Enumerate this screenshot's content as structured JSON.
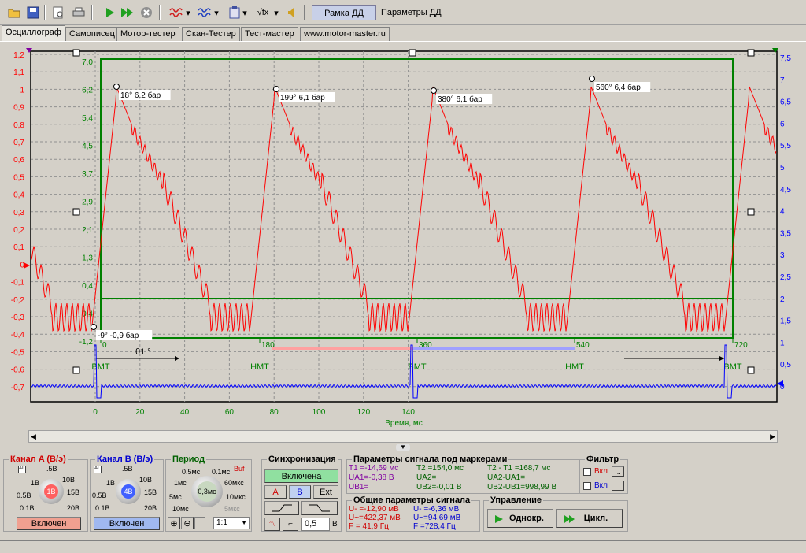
{
  "toolbar": {
    "frame_button": "Рамка ДД",
    "params_label": "Параметры ДД"
  },
  "tabs": [
    {
      "label": "Осциллограф"
    },
    {
      "label": "Самописец"
    },
    {
      "label": "Мотор-тестер"
    },
    {
      "label": "Скан-Тестер"
    },
    {
      "label": "Тест-мастер"
    },
    {
      "label": "www.motor-master.ru"
    }
  ],
  "plot": {
    "left_axis_ticks": [
      "1,2",
      "1,1",
      "1",
      "0,9",
      "0,8",
      "0,7",
      "0,6",
      "0,5",
      "0,4",
      "0,3",
      "0,2",
      "0,1",
      "0",
      "-0,1",
      "-0,2",
      "-0,3",
      "-0,4",
      "-0,5",
      "-0,6",
      "-0,7"
    ],
    "right_axis_ticks": [
      "7,5",
      "7",
      "6,5",
      "6",
      "5,5",
      "5",
      "4,5",
      "4",
      "3,5",
      "3",
      "2,5",
      "2",
      "1,5",
      "1",
      "0,5",
      "0"
    ],
    "pressure_ticks": [
      "7,0",
      "6,2",
      "5,4",
      "4,5",
      "3,7",
      "2,9",
      "2,1",
      "1,3",
      "0,4",
      "-0,4",
      "-1,2"
    ],
    "x_ticks": [
      "0",
      "20",
      "40",
      "60",
      "80",
      "100",
      "120",
      "140"
    ],
    "x_label": "Время, мс",
    "angle_marks": [
      "0",
      "180",
      "360",
      "540",
      "720"
    ],
    "dead_centers": [
      "ВМТ",
      "НМТ",
      "ВМТ",
      "НМТ",
      "ВМТ"
    ],
    "angle_label": "θ1 °",
    "annotations": [
      "18° 6,2 бар",
      "199° 6,1 бар",
      "380° 6,1 бар",
      "560° 6,4 бар",
      "-9° -0,9 бар"
    ]
  },
  "chA": {
    "title": "Канал A (В/э)",
    "ranges": [
      ".5В",
      "1В",
      "10В",
      "0.5В",
      "15В",
      "0.1В",
      "20В"
    ],
    "value": "1В",
    "state": "Включен"
  },
  "chB": {
    "title": "Канал B (В/э)",
    "ranges": [
      ".5В",
      "1В",
      "10В",
      "0.5В",
      "15В",
      "0.1В",
      "20В"
    ],
    "value": "4В",
    "state": "Включен"
  },
  "period": {
    "title": "Период",
    "ranges": [
      "0.5мс",
      "0.1мс",
      "1мс",
      "60мкс",
      "5мс",
      "10мкс",
      "10мс",
      "5мкс"
    ],
    "value": "0,3мс",
    "buf": "Buf",
    "scale": "1:1"
  },
  "sync": {
    "title": "Синхронизация",
    "state": "Включена",
    "src_a": "A",
    "src_b": "B",
    "src_ext": "Ext",
    "level": "0,5",
    "unit": "В"
  },
  "markers": {
    "title": "Параметры сигнала под маркерами",
    "t1": "T1 =-14,69 мс",
    "ua1": "UA1=-0,38 В",
    "ub1": "UB1=",
    "t2": "T2 =154,0 мс",
    "ua2": "UA2=",
    "ub2": "UB2=-0,01 В",
    "dt": "T2 - T1 =168,7 мс",
    "dua": "UA2-UA1=",
    "dub": "UB2-UB1=998,99 В"
  },
  "general": {
    "title": "Общие параметры сигнала",
    "a_dc": "U- =-12,90 мВ",
    "a_ac": "U~=422,37 мВ",
    "a_f": "F = 41,9 Гц",
    "b_dc": "U- =-6,36 мВ",
    "b_ac": "U~=94,69 мВ",
    "b_f": "F =728,4 Гц"
  },
  "filter": {
    "title": "Фильтр",
    "on1": "Вкл",
    "on2": "Вкл",
    "more": "..."
  },
  "control": {
    "title": "Управление",
    "single": "Однокр.",
    "cycle": "Цикл."
  },
  "colors": {
    "channel_a": "#ff0000",
    "channel_b": "#0000ff",
    "pressure": "#008000"
  }
}
